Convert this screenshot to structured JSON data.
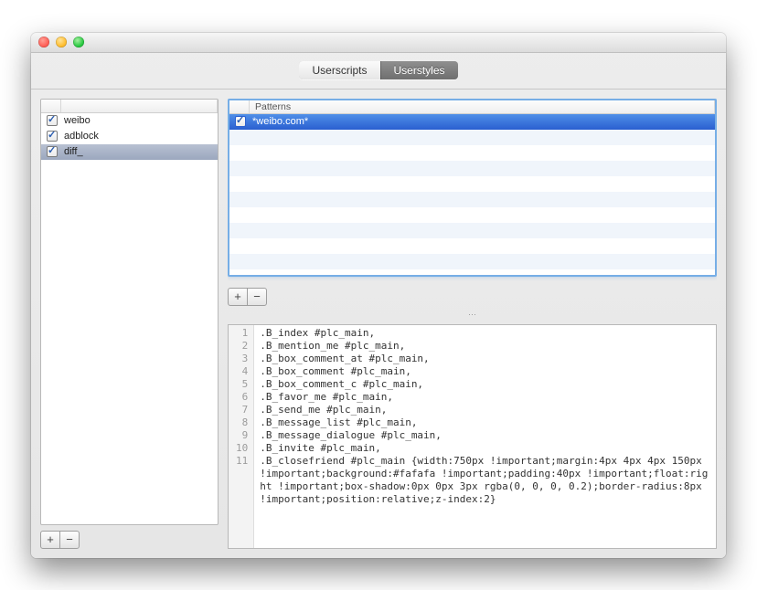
{
  "tabs": {
    "userscripts": "Userscripts",
    "userstyles": "Userstyles",
    "active": "userstyles"
  },
  "sidebar": {
    "header": "",
    "items": [
      {
        "label": "weibo",
        "checked": true,
        "selected": false
      },
      {
        "label": "adblock",
        "checked": true,
        "selected": false
      },
      {
        "label": "diff_",
        "checked": true,
        "selected": true
      }
    ]
  },
  "patterns": {
    "header": "Patterns",
    "items": [
      {
        "label": "*weibo.com*",
        "checked": true,
        "selected": true
      }
    ],
    "blank_rows": 9
  },
  "buttons": {
    "plus": "+",
    "minus": "−"
  },
  "editor": {
    "lines": [
      ".B_index #plc_main,",
      ".B_mention_me #plc_main,",
      ".B_box_comment_at #plc_main,",
      ".B_box_comment #plc_main,",
      ".B_box_comment_c #plc_main,",
      ".B_favor_me #plc_main,",
      ".B_send_me #plc_main,",
      ".B_message_list #plc_main,",
      ".B_message_dialogue #plc_main,",
      ".B_invite #plc_main,",
      ".B_closefriend #plc_main {width:750px !important;margin:4px 4px 4px 150px !important;background:#fafafa !important;padding:40px !important;float:right !important;box-shadow:0px 0px 3px rgba(0, 0, 0, 0.2);border-radius:8px !important;position:relative;z-index:2}"
    ]
  }
}
